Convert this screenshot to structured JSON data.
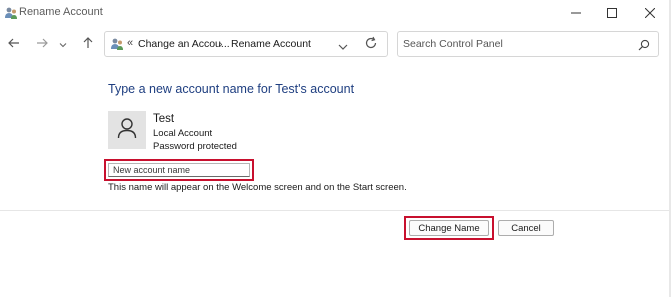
{
  "window": {
    "title": "Rename Account",
    "controls": [
      "minimize",
      "maximize",
      "close"
    ]
  },
  "navigation": {
    "breadcrumb_overflow": "«",
    "breadcrumbs": [
      "Change an Accou...",
      "Rename Account"
    ],
    "separator": "›"
  },
  "search": {
    "placeholder": "Search Control Panel"
  },
  "main": {
    "heading": "Type a new account name for Test's account",
    "account": {
      "name": "Test",
      "type": "Local Account",
      "status": "Password protected"
    },
    "new_name_field": {
      "value": "",
      "placeholder": "New account name"
    },
    "hint": "This name will appear on the Welcome screen and on the Start screen."
  },
  "buttons": {
    "change_name": "Change Name",
    "cancel": "Cancel"
  },
  "colors": {
    "heading": "#1e3e80",
    "highlight": "#c8102e"
  }
}
